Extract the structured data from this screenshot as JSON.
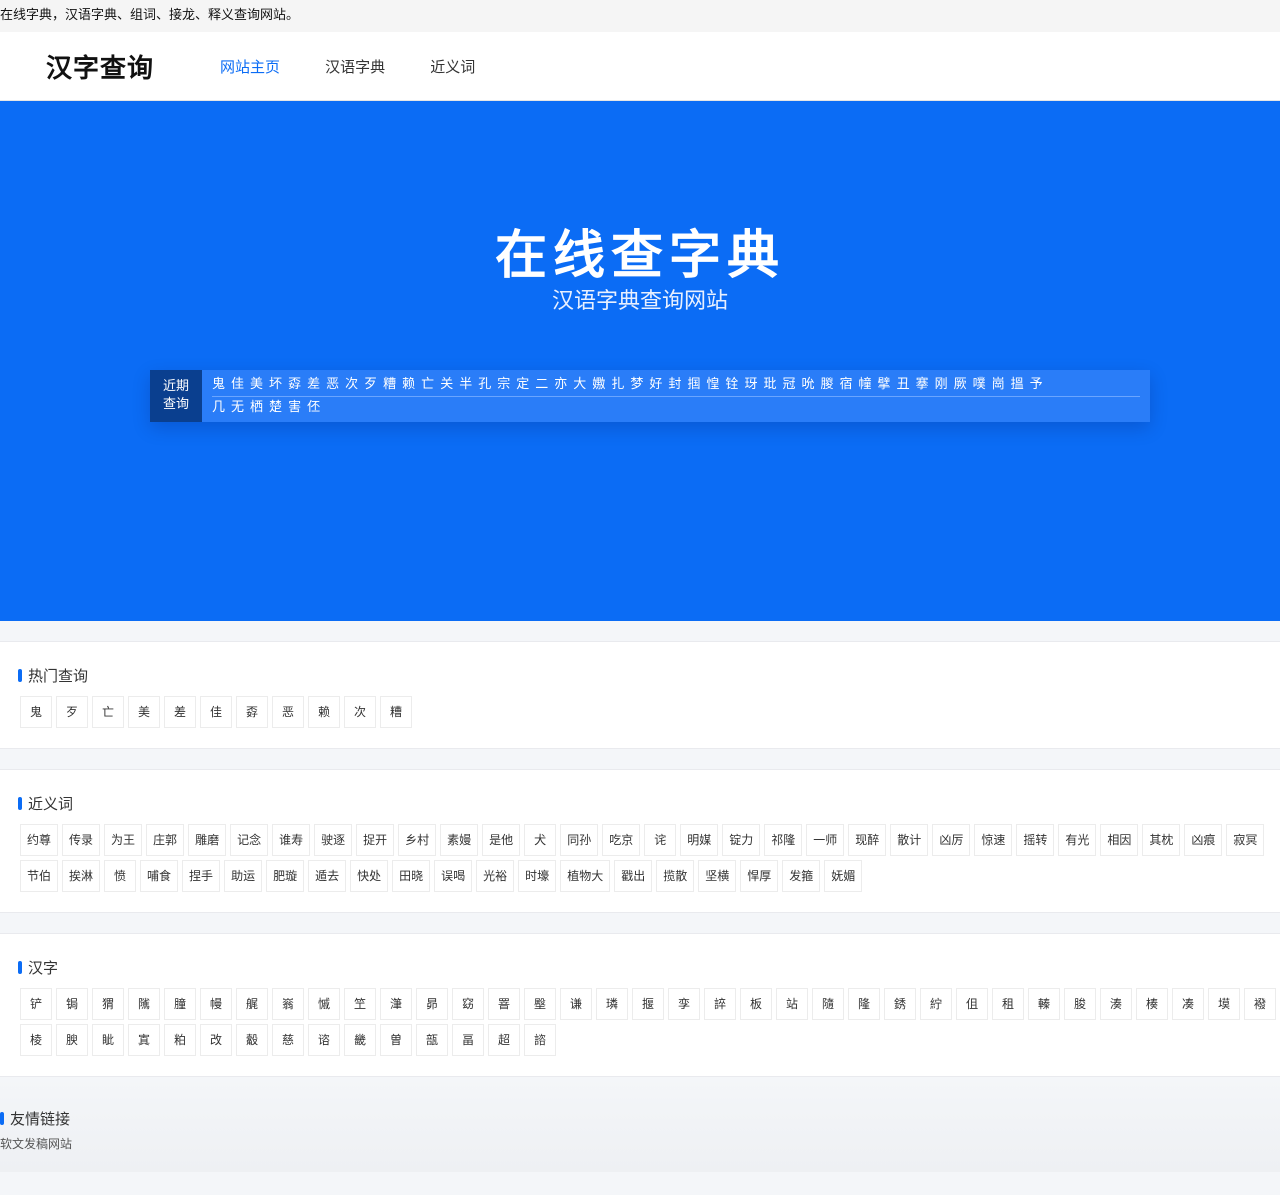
{
  "topline": "在线字典，汉语字典、组词、接龙、释义查询网站。",
  "header": {
    "logo": "汉字查询",
    "nav": [
      "网站主页",
      "汉语字典",
      "近义词"
    ]
  },
  "hero": {
    "title": "在线查字典",
    "subtitle": "汉语字典查询网站",
    "recent_label_1": "近期",
    "recent_label_2": "查询",
    "recent_row1": [
      "鬼",
      "佳",
      "美",
      "坏",
      "孬",
      "差",
      "恶",
      "次",
      "歹",
      "糟",
      "赖",
      "亡",
      "关",
      "半",
      "孔",
      "宗",
      "定",
      "二",
      "亦",
      "大",
      "嫐",
      "扎",
      "梦",
      "好",
      "封",
      "掴",
      "惶",
      "铨",
      "玡",
      "玭",
      "冠",
      "吮",
      "朡",
      "宿",
      "幢",
      "擘",
      "丑",
      "搴",
      "刚",
      "厥",
      "噗",
      "崗",
      "搵",
      "予"
    ],
    "recent_row2": [
      "几",
      "无",
      "栖",
      "楚",
      "害",
      "伾"
    ]
  },
  "hot": {
    "title": "热门查询",
    "items": [
      "鬼",
      "歹",
      "亡",
      "美",
      "差",
      "佳",
      "孬",
      "恶",
      "赖",
      "次",
      "糟"
    ]
  },
  "synonyms": {
    "title": "近义词",
    "items": [
      "约尊",
      "传录",
      "为王",
      "庄郭",
      "雕磨",
      "记念",
      "谁寿",
      "驶逐",
      "捉开",
      "乡村",
      "素嫚",
      "是他",
      "犬",
      "同孙",
      "吃京",
      "诧",
      "明媒",
      "锭力",
      "祁隆",
      "一师",
      "现醉",
      "散计",
      "凶厉",
      "惊速",
      "摇转",
      "有光",
      "相因",
      "其枕",
      "凶痕",
      "寂冥",
      "节伯",
      "挨淋",
      "愤",
      "哺食",
      "捏手",
      "助运",
      "肥璇",
      "遁去",
      "快处",
      "田晓",
      "误喝",
      "光裕",
      "时壕",
      "植物大",
      "戳出",
      "揽散",
      "坚横",
      "悍厚",
      "发箍",
      "妩媚"
    ]
  },
  "hanzi": {
    "title": "汉字",
    "items": [
      "铲",
      "锔",
      "猬",
      "隲",
      "朣",
      "幔",
      "艉",
      "嵡",
      "慽",
      "笁",
      "潷",
      "昴",
      "窈",
      "罯",
      "壂",
      "谦",
      "璘",
      "揠",
      "孪",
      "誶",
      "板",
      "站",
      "隨",
      "隆",
      "銹",
      "紵",
      "伹",
      "租",
      "轃",
      "朘",
      "湊",
      "楱",
      "凑",
      "塻",
      "襏",
      "棱",
      "腴",
      "眦",
      "寘",
      "粕",
      "改",
      "觳",
      "慈",
      "谘",
      "畿",
      "曽",
      "瓿",
      "畐",
      "超",
      "諮"
    ]
  },
  "friend": {
    "title": "友情链接",
    "links": [
      "软文发稿网站"
    ]
  },
  "colors": {
    "accent": "#0b6cf5",
    "hero_bg": "#0b6cf5",
    "recent_label_bg": "#0a3f8f"
  }
}
